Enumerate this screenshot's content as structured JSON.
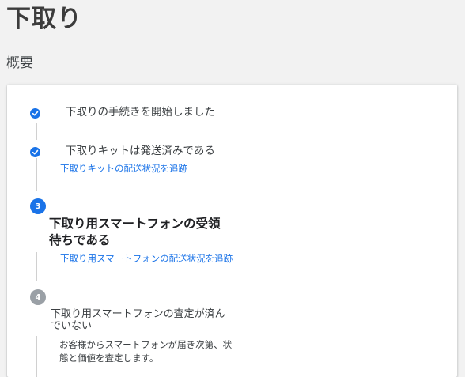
{
  "page": {
    "title": "下取り",
    "section_heading": "概要"
  },
  "steps": [
    {
      "status": "completed",
      "icon": "check-icon",
      "title": "下取りの手続きを開始しました"
    },
    {
      "status": "completed",
      "icon": "check-icon",
      "title": "下取りキットは発送済みである",
      "link": "下取りキットの配送状況を追跡"
    },
    {
      "status": "current",
      "number": "3",
      "title": "下取り用スマートフォンの受領待ちである",
      "link": "下取り用スマートフォンの配送状況を追跡"
    },
    {
      "status": "upcoming",
      "number": "4",
      "title": "下取り用スマートフォンの査定が済んでいない",
      "description": "お客様からスマートフォンが届き次第、状態と価値を査定します。"
    }
  ],
  "colors": {
    "accent": "#1a73e8",
    "inactive": "#9aa0a6",
    "background": "#f2f2f2",
    "card": "#ffffff"
  }
}
